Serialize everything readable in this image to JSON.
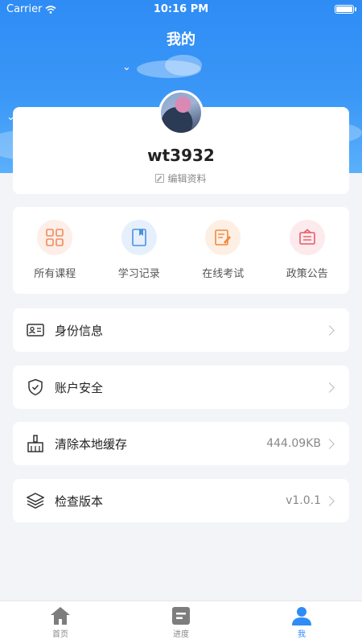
{
  "status_bar": {
    "carrier": "Carrier",
    "time": "10:16 PM"
  },
  "header": {
    "title": "我的"
  },
  "profile": {
    "username": "wt3932",
    "edit_label": "编辑资料"
  },
  "quick_actions": [
    {
      "label": "所有课程",
      "icon": "grid-icon",
      "color": "#f08a5d"
    },
    {
      "label": "学习记录",
      "icon": "notebook-icon",
      "color": "#4a90e2"
    },
    {
      "label": "在线考试",
      "icon": "exam-edit-icon",
      "color": "#f08a3c"
    },
    {
      "label": "政策公告",
      "icon": "announcement-icon",
      "color": "#e55b6a"
    }
  ],
  "menu": [
    {
      "label": "身份信息",
      "value": "",
      "icon": "id-card-icon"
    },
    {
      "label": "账户安全",
      "value": "",
      "icon": "shield-check-icon"
    },
    {
      "label": "清除本地缓存",
      "value": "444.09KB",
      "icon": "broom-icon"
    },
    {
      "label": "检查版本",
      "value": "v1.0.1",
      "icon": "layers-icon"
    }
  ],
  "tabbar": [
    {
      "label": "首页",
      "icon": "home-icon",
      "active": false
    },
    {
      "label": "进度",
      "icon": "progress-icon",
      "active": false
    },
    {
      "label": "我",
      "icon": "user-icon",
      "active": true
    }
  ],
  "colors": {
    "accent": "#2f8cf5",
    "background": "#f3f4f7"
  }
}
